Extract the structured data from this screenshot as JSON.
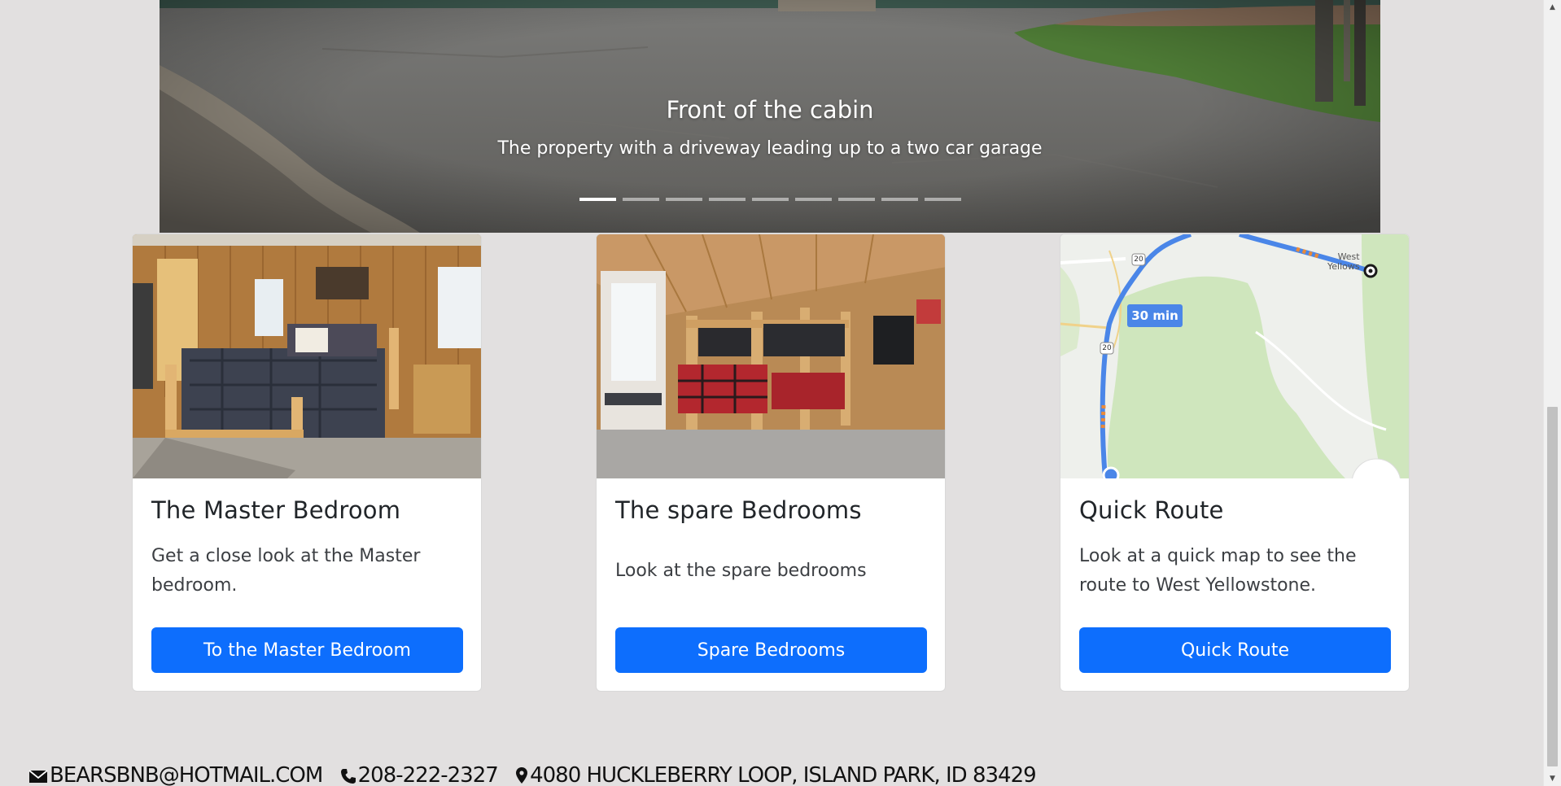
{
  "carousel": {
    "slide_title": "Front of the cabin",
    "slide_text": "The property with a driveway leading up to a two car garage",
    "indicator_count": 9,
    "active_indicator": 1
  },
  "cards": [
    {
      "title": "The Master Bedroom",
      "text": "Get a close look at the Master bedroom.",
      "button": "To the Master Bedroom"
    },
    {
      "title": "The spare Bedrooms",
      "text": "Look at the spare bedrooms",
      "button": "Spare Bedrooms"
    },
    {
      "title": "Quick Route",
      "text": "Look at a quick map to see the route to West Yellowstone.",
      "button": "Quick Route",
      "map": {
        "route_time": "30 min",
        "shield_labels": [
          "20",
          "20"
        ],
        "place_label_1": "West",
        "place_label_2": "Yellows"
      }
    }
  ],
  "footer": {
    "email": "BEARSBNB@HOTMAIL.COM",
    "phone": "208-222-2327",
    "address": "4080 HUCKLEBERRY LOOP, ISLAND PARK, ID 83429"
  },
  "colors": {
    "page_bg": "#e2e0e0",
    "primary_button": "#0d6efd",
    "map_green": "#cfe6bd",
    "map_route": "#4a86e8"
  },
  "icons": {
    "email": "envelope-icon",
    "phone": "phone-icon",
    "address": "map-marker-icon"
  }
}
